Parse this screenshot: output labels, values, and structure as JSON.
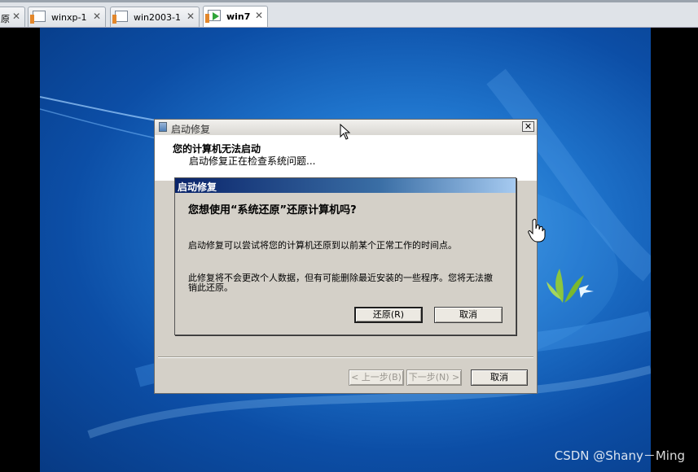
{
  "tabs": [
    {
      "label": "原",
      "active": false
    },
    {
      "label": "winxp-1",
      "active": false
    },
    {
      "label": "win2003-1",
      "active": false
    },
    {
      "label": "win7",
      "active": true
    }
  ],
  "tab_close_glyph": "✕",
  "main_window": {
    "title": "启动修复",
    "close_glyph": "✕",
    "heading": "您的计算机无法启动",
    "subheading": "启动修复正在检查系统问题...",
    "back_button": "< 上一步(B)",
    "next_button": "下一步(N) >",
    "cancel_button": "取消"
  },
  "restore_dialog": {
    "title": "启动修复",
    "question": "您想使用“系统还原”还原计算机吗?",
    "paragraph1": "启动修复可以尝试将您的计算机还原到以前某个正常工作的时间点。",
    "paragraph2": "此修复将不会更改个人数据，但有可能删除最近安装的一些程序。您将无法撤销此还原。",
    "restore_button": "还原(R)",
    "cancel_button": "取消"
  },
  "watermark": "CSDN @Shany－Ming",
  "colors": {
    "desktop": "#1f74cc",
    "dialog_face": "#d4d0c8",
    "dialog_title": "#0a246a",
    "logo_green": "#8cc63f"
  },
  "icons": {
    "vm_tab": "vm-icon",
    "running_vm": "play-icon",
    "pointer": "arrow-cursor-icon",
    "hand": "hand-cursor-icon",
    "logo": "windows-bird-logo-icon"
  }
}
